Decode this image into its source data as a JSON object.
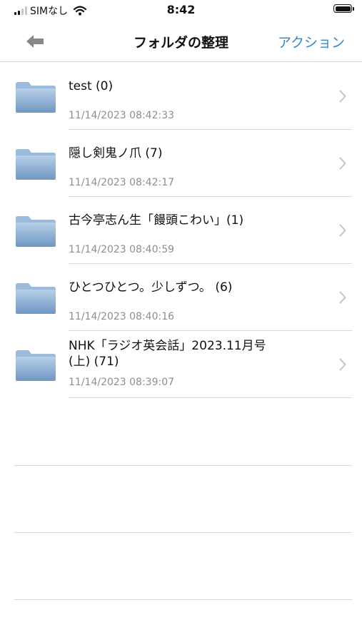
{
  "status_bar": {
    "carrier": "SIMなし",
    "time": "8:42",
    "icons": [
      "signal-icon",
      "wifi-icon",
      "battery-icon"
    ]
  },
  "nav": {
    "title": "フォルダの整理",
    "action_label": "アクション",
    "back_icon": "arrow-left-icon"
  },
  "colors": {
    "accent": "#3a87c8",
    "folder": "#8fb2d6",
    "separator": "#d9d9d9",
    "date_text": "#8e8e8e"
  },
  "folders": [
    {
      "name": "test (0)",
      "date": "11/14/2023 08:42:33"
    },
    {
      "name": "隠し剣鬼ノ爪 (7)",
      "date": "11/14/2023 08:42:17"
    },
    {
      "name": "古今亭志ん生「饅頭こわい」(1)",
      "date": "11/14/2023 08:40:59"
    },
    {
      "name": "ひとつひとつ。少しずつ。 (6)",
      "date": "11/14/2023 08:40:16"
    },
    {
      "name": "NHK「ラジオ英会話」2023.11月号(上) (71)",
      "date": "11/14/2023 08:39:07"
    }
  ]
}
